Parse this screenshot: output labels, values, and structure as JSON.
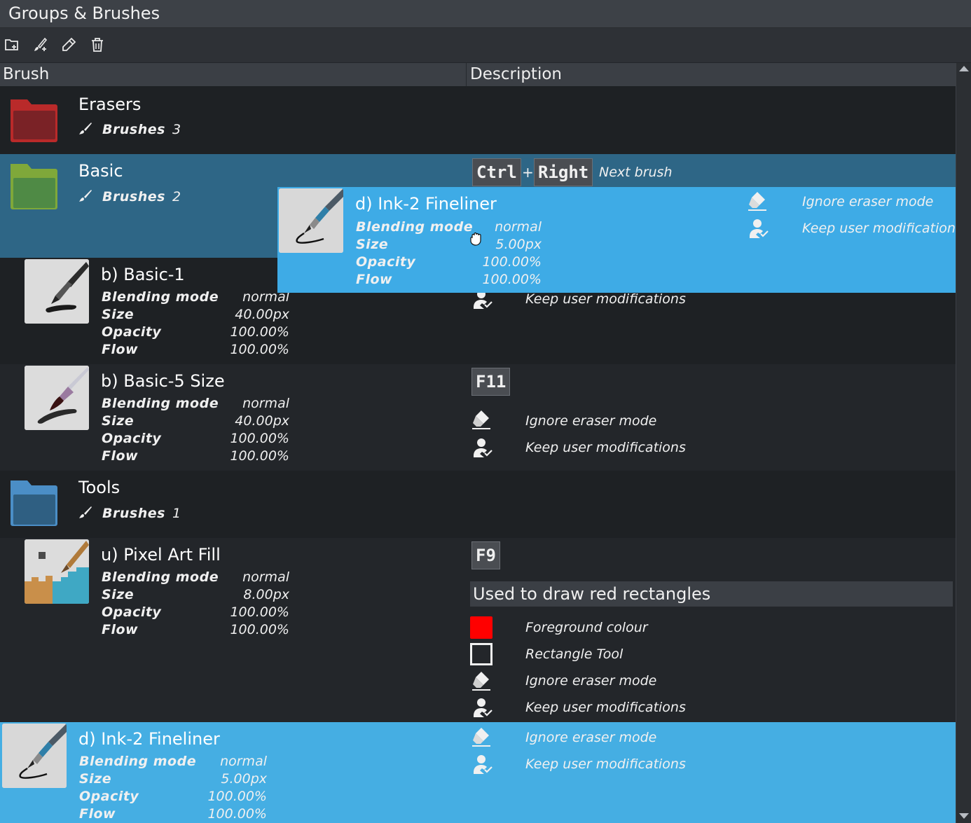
{
  "window": {
    "title": "Groups & Brushes"
  },
  "toolbar": {
    "icons": [
      "new-folder-icon",
      "new-brush-icon",
      "edit-icon",
      "delete-icon"
    ]
  },
  "columns": {
    "brush": "Brush",
    "description": "Description"
  },
  "groups": [
    {
      "name": "Erasers",
      "count_label": "Brushes",
      "count": "3",
      "color": "#c9302c"
    },
    {
      "name": "Basic",
      "count_label": "Brushes",
      "count": "2",
      "color": "#7aa83a"
    },
    {
      "name": "Tools",
      "count_label": "Brushes",
      "count": "1",
      "color": "#4a8fc7"
    }
  ],
  "basic_shortcut": {
    "key1": "Ctrl",
    "plus": "+",
    "key2": "Right",
    "desc": "Next brush"
  },
  "brushes": [
    {
      "name": "b) Basic-1",
      "blend_label": "Blending mode",
      "blend": "normal",
      "size_label": "Size",
      "size": "40.00px",
      "opacity_label": "Opacity",
      "opacity": "100.00%",
      "flow_label": "Flow",
      "flow": "100.00%",
      "keep": "Keep user modifications"
    },
    {
      "name": "b) Basic-5 Size",
      "blend_label": "Blending mode",
      "blend": "normal",
      "size_label": "Size",
      "size": "40.00px",
      "opacity_label": "Opacity",
      "opacity": "100.00%",
      "flow_label": "Flow",
      "flow": "100.00%",
      "shortcut": "F11",
      "ignore": "Ignore eraser mode",
      "keep": "Keep user modifications"
    },
    {
      "name": "u) Pixel Art Fill",
      "blend_label": "Blending mode",
      "blend": "normal",
      "size_label": "Size",
      "size": "8.00px",
      "opacity_label": "Opacity",
      "opacity": "100.00%",
      "flow_label": "Flow",
      "flow": "100.00%",
      "shortcut": "F9",
      "comment": "Used to draw red rectangles",
      "fg": "Foreground colour",
      "fg_color": "#ff0000",
      "tool": "Rectangle Tool",
      "ignore": "Ignore eraser mode",
      "keep": "Keep user modifications"
    },
    {
      "name": "d) Ink-2 Fineliner",
      "blend_label": "Blending mode",
      "blend": "normal",
      "size_label": "Size",
      "size": "5.00px",
      "opacity_label": "Opacity",
      "opacity": "100.00%",
      "flow_label": "Flow",
      "flow": "100.00%",
      "ignore": "Ignore eraser mode",
      "keep": "Keep user modifications"
    }
  ],
  "drag_item": {
    "name": "d) Ink-2 Fineliner",
    "blend_label": "Blending mode",
    "blend": "normal",
    "size_label": "Size",
    "size": "5.00px",
    "opacity_label": "Opacity",
    "opacity": "100.00%",
    "flow_label": "Flow",
    "flow": "100.00%",
    "ignore": "Ignore eraser mode",
    "keep": "Keep user modifications"
  }
}
